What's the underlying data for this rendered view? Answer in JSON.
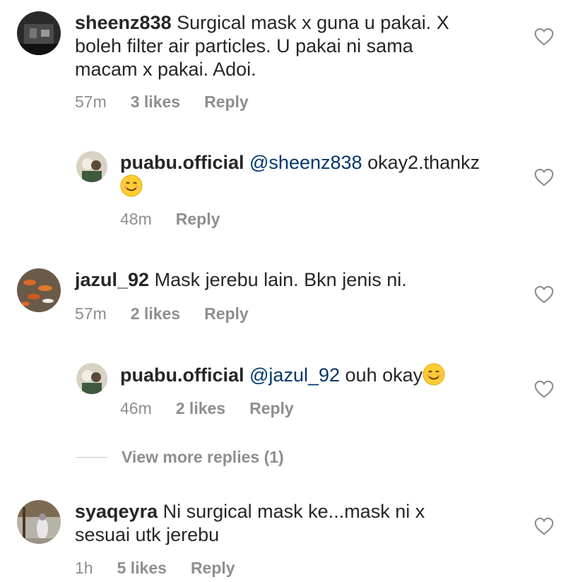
{
  "comments": [
    {
      "username": "sheenz838",
      "text_lines": [
        "Surgical mask x guna u pakai. X",
        "boleh filter air particles. U pakai ni sama",
        "macam x pakai. Adoi."
      ],
      "time": "57m",
      "likes": "3 likes",
      "reply": "Reply"
    },
    {
      "username": "puabu.official",
      "mention": "@sheenz838",
      "text": "okay2.thankz",
      "time": "48m",
      "reply": "Reply"
    },
    {
      "username": "jazul_92",
      "text": "Mask jerebu lain. Bkn jenis ni.",
      "time": "57m",
      "likes": "2 likes",
      "reply": "Reply"
    },
    {
      "username": "puabu.official",
      "mention": "@jazul_92",
      "text": "ouh okay",
      "time": "46m",
      "likes": "2 likes",
      "reply": "Reply"
    },
    {
      "username": "syaqeyra",
      "text_lines": [
        "Ni surgical mask ke...mask ni x",
        "sesuai utk jerebu"
      ],
      "time": "1h",
      "likes": "5 likes",
      "reply": "Reply"
    }
  ],
  "view_more": "View more replies (1)",
  "colors": {
    "text": "#262626",
    "meta": "#8e8e8e",
    "mention": "#00376b"
  }
}
